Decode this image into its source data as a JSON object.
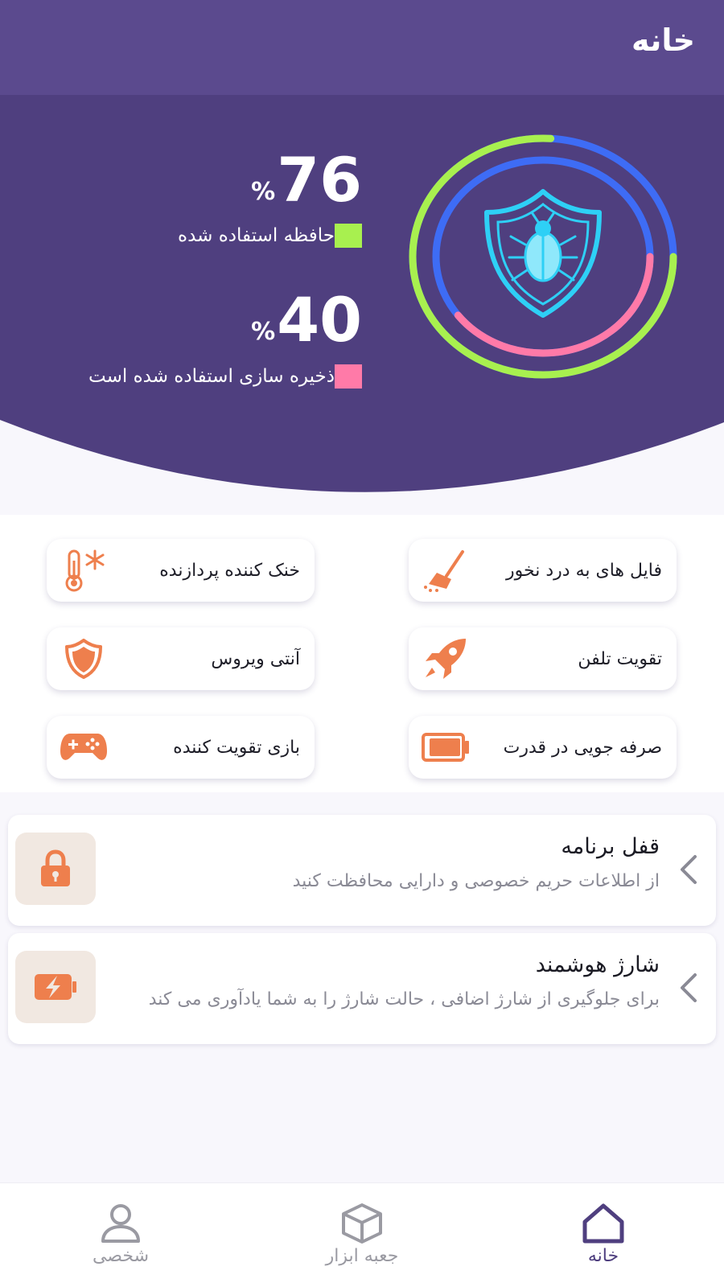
{
  "header": {
    "title": "خانه",
    "memory": {
      "value": "76",
      "percent_sign": "%",
      "label": "حافظه استفاده شده",
      "fraction": 0.76,
      "color": "#a8f04f"
    },
    "storage": {
      "value": "40",
      "percent_sign": "%",
      "label": "ذخیره سازی استفاده شده است",
      "fraction": 0.4,
      "color": "#ff7aa8"
    },
    "colors": {
      "background": "#4f3f7f",
      "top_band": "#5b4a8e",
      "ring_blue": "#3e6cf5",
      "shield": "#2ed0f6"
    },
    "center_icon": "shield-bug-icon"
  },
  "tools": [
    {
      "label": "فایل های به درد نخور",
      "icon": "broom-icon"
    },
    {
      "label": "خنک کننده پردازنده",
      "icon": "thermometer-snowflake-icon"
    },
    {
      "label": "تقویت تلفن",
      "icon": "rocket-icon"
    },
    {
      "label": "آنتی ویروس",
      "icon": "shield-icon"
    },
    {
      "label": "صرفه جویی در قدرت",
      "icon": "battery-icon"
    },
    {
      "label": "بازی تقویت کننده",
      "icon": "gamepad-icon"
    }
  ],
  "cards": [
    {
      "title": "قفل برنامه",
      "description": "از اطلاعات حریم خصوصی و دارایی محافظت کنید",
      "icon": "lock-icon"
    },
    {
      "title": "شارژ هوشمند",
      "description": "برای جلوگیری از شارژ اضافی ، حالت شارژ را به شما یادآوری می کند",
      "icon": "battery-bolt-icon"
    }
  ],
  "nav": [
    {
      "label": "خانه",
      "icon": "home-icon",
      "active": true
    },
    {
      "label": "جعبه ابزار",
      "icon": "box-icon",
      "active": false
    },
    {
      "label": "شخصی",
      "icon": "user-icon",
      "active": false
    }
  ],
  "accent": "#ee7f4d",
  "nav_active_color": "#4f3f7f",
  "nav_inactive_color": "#9a9aa2"
}
